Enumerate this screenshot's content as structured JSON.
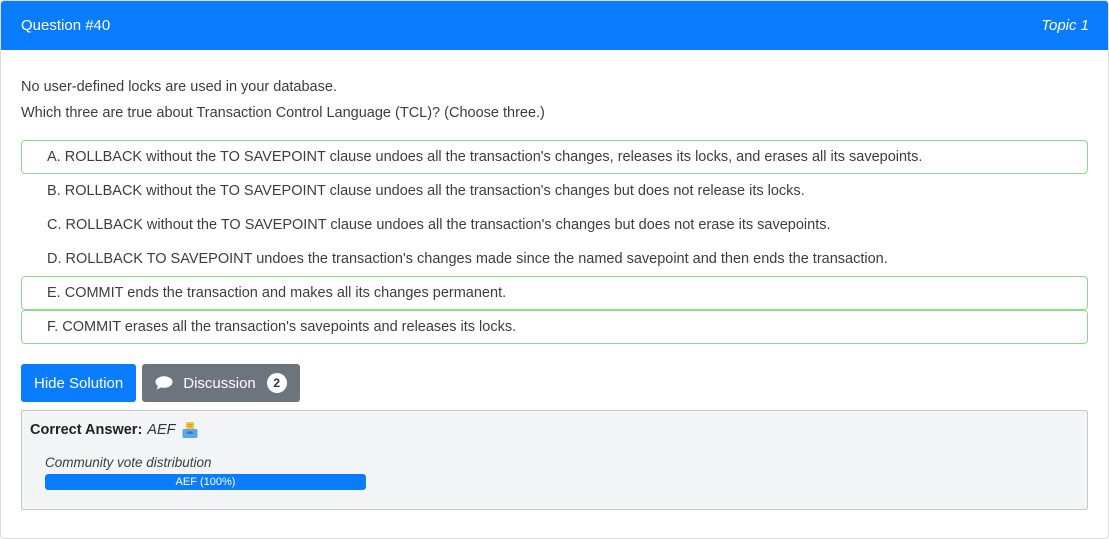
{
  "header": {
    "question_number": "Question #40",
    "topic": "Topic 1"
  },
  "question": {
    "line1": "No user-defined locks are used in your database.",
    "line2": "Which three are true about Transaction Control Language (TCL)? (Choose three.)"
  },
  "choices": [
    {
      "text": "A. ROLLBACK without the TO SAVEPOINT clause undoes all the transaction's changes, releases its locks, and erases all its savepoints.",
      "correct": true
    },
    {
      "text": "B. ROLLBACK without the TO SAVEPOINT clause undoes all the transaction's changes but does not release its locks.",
      "correct": false
    },
    {
      "text": "C. ROLLBACK without the TO SAVEPOINT clause undoes all the transaction's changes but does not erase its savepoints.",
      "correct": false
    },
    {
      "text": "D. ROLLBACK TO SAVEPOINT undoes the transaction's changes made since the named savepoint and then ends the transaction.",
      "correct": false
    },
    {
      "text": "E. COMMIT ends the transaction and makes all its changes permanent.",
      "correct": true
    },
    {
      "text": "F. COMMIT erases all the transaction's savepoints and releases its locks.",
      "correct": true
    }
  ],
  "buttons": {
    "hide_solution": "Hide Solution",
    "discussion": "Discussion",
    "discussion_count": "2",
    "discussion_icon": "comment-icon"
  },
  "answer": {
    "label": "Correct Answer:",
    "value": "AEF",
    "icon": "inbox-icon"
  },
  "vote": {
    "title": "Community vote distribution",
    "bar_label": "AEF (100%)",
    "percent": 100
  },
  "colors": {
    "accent": "#0a7cff",
    "correct_border": "#8fd98f",
    "secondary_button": "#6c757d"
  }
}
